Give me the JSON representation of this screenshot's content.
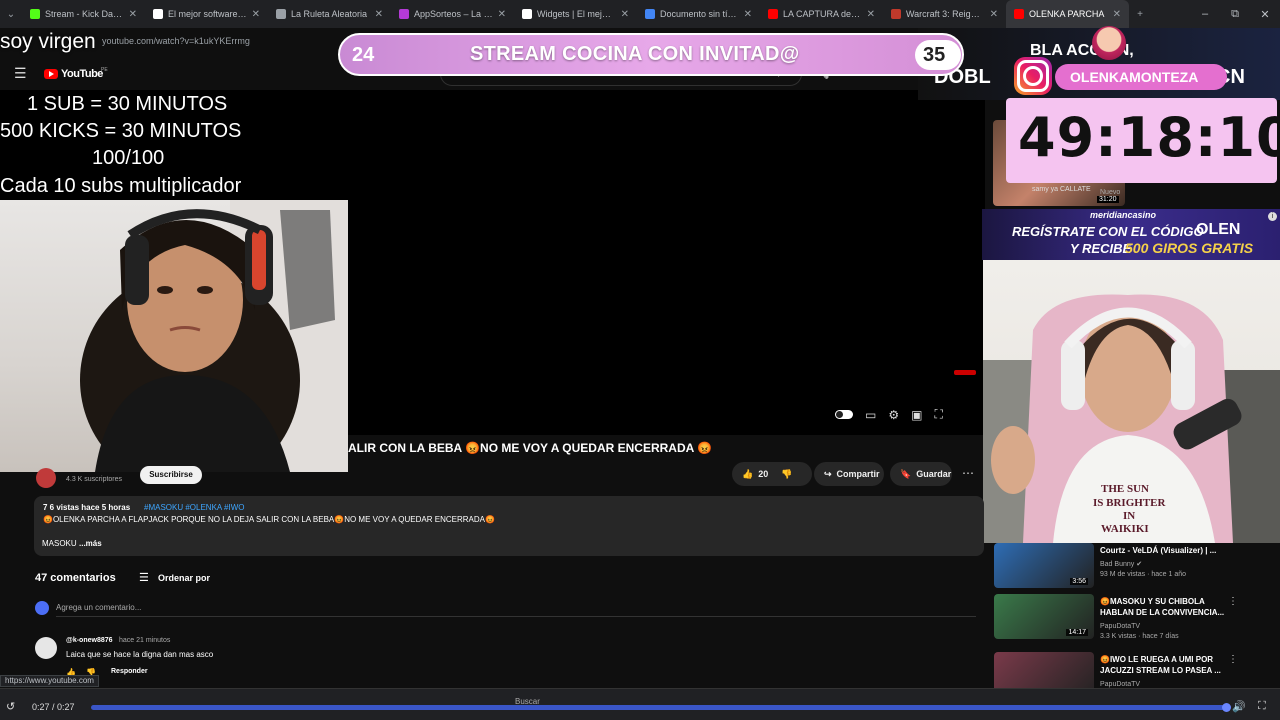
{
  "browser": {
    "tabs": [
      {
        "label": "Stream - Kick Dashbo",
        "color": "#53fc18"
      },
      {
        "label": "El mejor software pa",
        "color": "#ffffff"
      },
      {
        "label": "La Ruleta Aleatoria",
        "color": "#9aa0a6"
      },
      {
        "label": "AppSorteos – La Rule",
        "color": "#b43ad6"
      },
      {
        "label": "Widgets | El mejor so",
        "color": "#ffffff"
      },
      {
        "label": "Documento sin título",
        "color": "#4285f4"
      },
      {
        "label": "LA CAPTURA del SH",
        "color": "#ff0000"
      },
      {
        "label": "Warcraft 3: Reign of",
        "color": "#c0392b"
      },
      {
        "label": "OLENKA PARCHA",
        "color": "#ff0000",
        "active": true
      }
    ],
    "new_tab": "+",
    "window_min": "–",
    "window_max": "⧉",
    "window_close": "✕",
    "url": "youtube.com/watch?v=k1ukYKErrmg",
    "status_url": "https://www.youtube.com"
  },
  "youtube": {
    "logo_text": "YouTube",
    "country_code": "PE",
    "menu_icon": "☰",
    "search_icon": "⌕",
    "mic_icon": "🎙"
  },
  "overlay": {
    "top_caption": "soy virgen",
    "rules": [
      "1 SUB      = 30 MINUTOS",
      "500 KICKS = 30 MINUTOS",
      "100/100",
      "Cada 10 subs multiplicador"
    ],
    "banner_left": "24",
    "banner_title": "STREAM COCINA CON INVITAD@",
    "banner_right": "35",
    "instagram_handle": "OLENKAMONTEZA",
    "timer": "49:18:10",
    "right_strip_top": "BLA ACCION,",
    "right_strip_left": "DOBL",
    "right_strip_right": "CN"
  },
  "casino_ad": {
    "brand": "meridiancasino",
    "line1": "REGÍSTRATE CON EL CÓDIGO",
    "code": "OLEN",
    "line2": "Y RECIBE",
    "giros": "500 GIROS GRATIS",
    "info": "i"
  },
  "video": {
    "title": "ALIR CON LA BEBA 😡NO ME VOY A QUEDAR ENCERRADA 😡",
    "subscribers": "4.3 K suscriptores",
    "subscribe": "Suscribirse",
    "likes": "20",
    "share": "Compartir",
    "save": "Guardar",
    "more": "⋯"
  },
  "description": {
    "meta": "7 6 vistas  hace 5 horas",
    "tags": "#MASOKU #OLENKA #IWO",
    "text": "😡OLENKA PARCHA A FLAPJACK PORQUE NO LA DEJA SALIR CON LA BEBA😡NO ME VOY A QUEDAR ENCERRADA😡",
    "more_prefix": "MASOKU",
    "more_label": "...más"
  },
  "comments": {
    "count": "47 comentarios",
    "sort_label": "Ordenar por",
    "add_placeholder": "Agrega un comentario...",
    "items": [
      {
        "user": "@k-onew8876",
        "time": "hace 21 minutos",
        "text": "Laica que se hace la digna dan mas asco",
        "reply": "Responder"
      }
    ]
  },
  "sidebar_partial": {
    "text": "samy ya CALLATE",
    "duration": "31:20",
    "badge": "Nuevo"
  },
  "related": [
    {
      "title": "Courtz - VeLDÁ (Visualizer) | ...",
      "channel": "Bad Bunny ✔",
      "meta": "93 M de vistas · hace 1 año",
      "duration": "3:56",
      "color": "#2e6db5"
    },
    {
      "title": "😡MASOKU Y SU CHIBOLA HABLAN DE LA CONVIVENCIA...",
      "channel": "PapuDotaTV",
      "meta": "3.3 K vistas · hace 7 días",
      "duration": "14:17",
      "color": "#3a7a4a"
    },
    {
      "title": "😡IWO LE RUEGA A UMI POR JACUZZI STREAM LO PASEA ...",
      "channel": "PapuDotaTV",
      "meta": "",
      "duration": "",
      "color": "#7a3a4a"
    }
  ],
  "player": {
    "time": "0:27 / 0:27",
    "progress": 1.0,
    "search": "Buscar",
    "volume_icon": "🔊",
    "fullscreen_icon": "⛶"
  }
}
